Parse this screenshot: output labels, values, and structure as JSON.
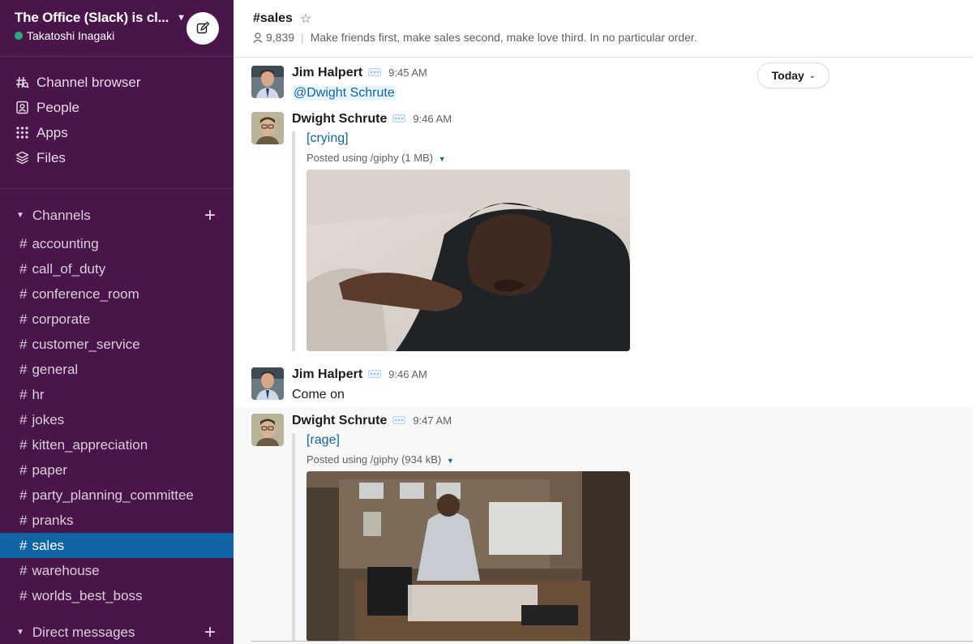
{
  "workspace": {
    "name": "The Office (Slack) is cl...",
    "user": "Takatoshi Inagaki"
  },
  "nav": [
    {
      "label": "Channel browser",
      "icon": "channel-browser-icon"
    },
    {
      "label": "People",
      "icon": "people-icon"
    },
    {
      "label": "Apps",
      "icon": "apps-icon"
    },
    {
      "label": "Files",
      "icon": "files-icon"
    }
  ],
  "channels_section": {
    "label": "Channels"
  },
  "channels": [
    "accounting",
    "call_of_duty",
    "conference_room",
    "corporate",
    "customer_service",
    "general",
    "hr",
    "jokes",
    "kitten_appreciation",
    "paper",
    "party_planning_committee",
    "pranks",
    "sales",
    "warehouse",
    "worlds_best_boss"
  ],
  "active_channel": "sales",
  "dm_section": {
    "label": "Direct messages"
  },
  "channel_header": {
    "title": "#sales",
    "members": "9,839",
    "topic": "Make friends first, make sales second, make love third. In no particular order."
  },
  "today_pill": "Today",
  "messages": [
    {
      "author": "Jim Halpert",
      "time": "9:45 AM",
      "mention": "@Dwight Schrute"
    },
    {
      "author": "Dwight Schrute",
      "time": "9:46 AM",
      "giphy_title": "[crying]",
      "posted": "Posted using /giphy",
      "size": "(1 MB)"
    },
    {
      "author": "Jim Halpert",
      "time": "9:46 AM",
      "text": "Come on"
    },
    {
      "author": "Dwight Schrute",
      "time": "9:47 AM",
      "giphy_title": "[rage]",
      "posted": "Posted using /giphy",
      "size": "(934 kB)"
    }
  ],
  "colors": {
    "sidebar": "#4a154b",
    "active": "#1164a3",
    "link": "#1264a3",
    "presence": "#2bac76"
  }
}
